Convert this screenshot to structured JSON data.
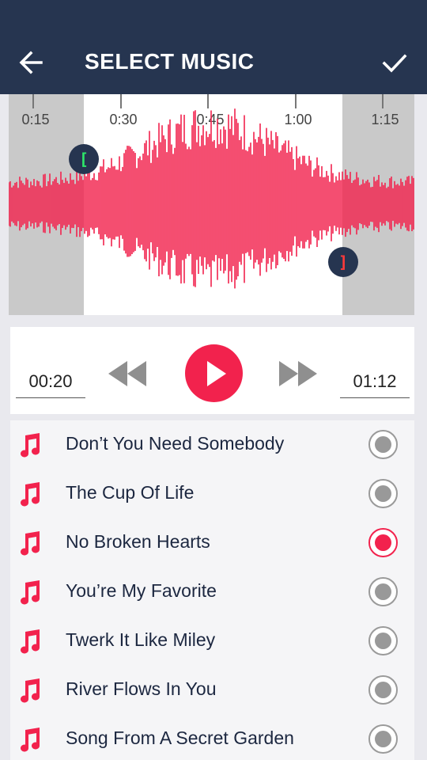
{
  "app": {
    "title": "SELECT MUSIC",
    "accent_color": "#f2224d",
    "header_color": "#263550",
    "icons": {
      "back": "arrow-left-icon",
      "confirm": "check-icon"
    }
  },
  "timeline": {
    "ticks": [
      "0:15",
      "0:30",
      "0:45",
      "1:00",
      "1:15"
    ],
    "trim_start_marker": "[",
    "trim_end_marker": "]"
  },
  "player": {
    "start_time": "00:20",
    "end_time": "01:12",
    "icons": {
      "rewind": "rewind-icon",
      "play": "play-icon",
      "forward": "fast-forward-icon"
    }
  },
  "songs": [
    {
      "title": "Don’t You Need Somebody",
      "selected": false
    },
    {
      "title": "The Cup Of Life",
      "selected": false
    },
    {
      "title": "No Broken Hearts",
      "selected": true
    },
    {
      "title": "You’re My Favorite",
      "selected": false
    },
    {
      "title": "Twerk It Like Miley",
      "selected": false
    },
    {
      "title": "River Flows In You",
      "selected": false
    },
    {
      "title": "Song From A Secret Garden",
      "selected": false
    }
  ]
}
